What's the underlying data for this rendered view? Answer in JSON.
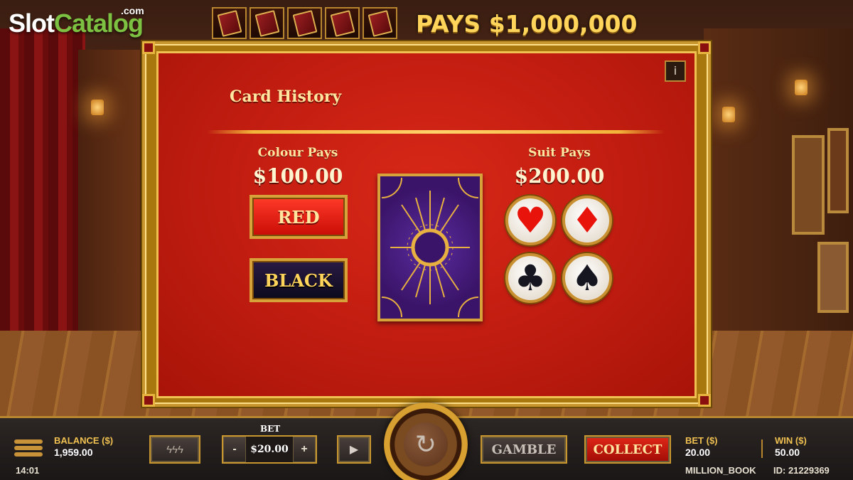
{
  "logo": {
    "slot": "Slot",
    "catalog": "Catalog",
    "com": ".com"
  },
  "top": {
    "pays_text": "PAYS $1,000,000",
    "book_count": 5
  },
  "panel": {
    "title": "Card History",
    "info_label": "i",
    "colour": {
      "title": "Colour Pays",
      "amount": "$100.00",
      "red_label": "RED",
      "black_label": "BLACK"
    },
    "suit": {
      "title": "Suit Pays",
      "amount": "$200.00",
      "symbols": {
        "hearts": "♥",
        "diamonds": "♦",
        "clubs": "♣",
        "spades": "♠"
      }
    }
  },
  "bottom": {
    "balance_label": "BALANCE ($)",
    "balance_value": "1,959.00",
    "time": "14:01",
    "bet_title": "BET",
    "bet_amount": "$20.00",
    "minus": "-",
    "plus": "+",
    "gamble_label": "GAMBLE",
    "collect_label": "COLLECT",
    "bet_label": "BET ($)",
    "bet_value": "20.00",
    "win_label": "WIN ($)",
    "win_value": "50.00",
    "game_name": "MILLION_BOOK",
    "game_id": "ID: 21229369"
  },
  "colors": {
    "gold": "#c8962e",
    "panel_red": "#c01c10",
    "card_purple": "#3a1468",
    "collect_red": "#e02818"
  }
}
